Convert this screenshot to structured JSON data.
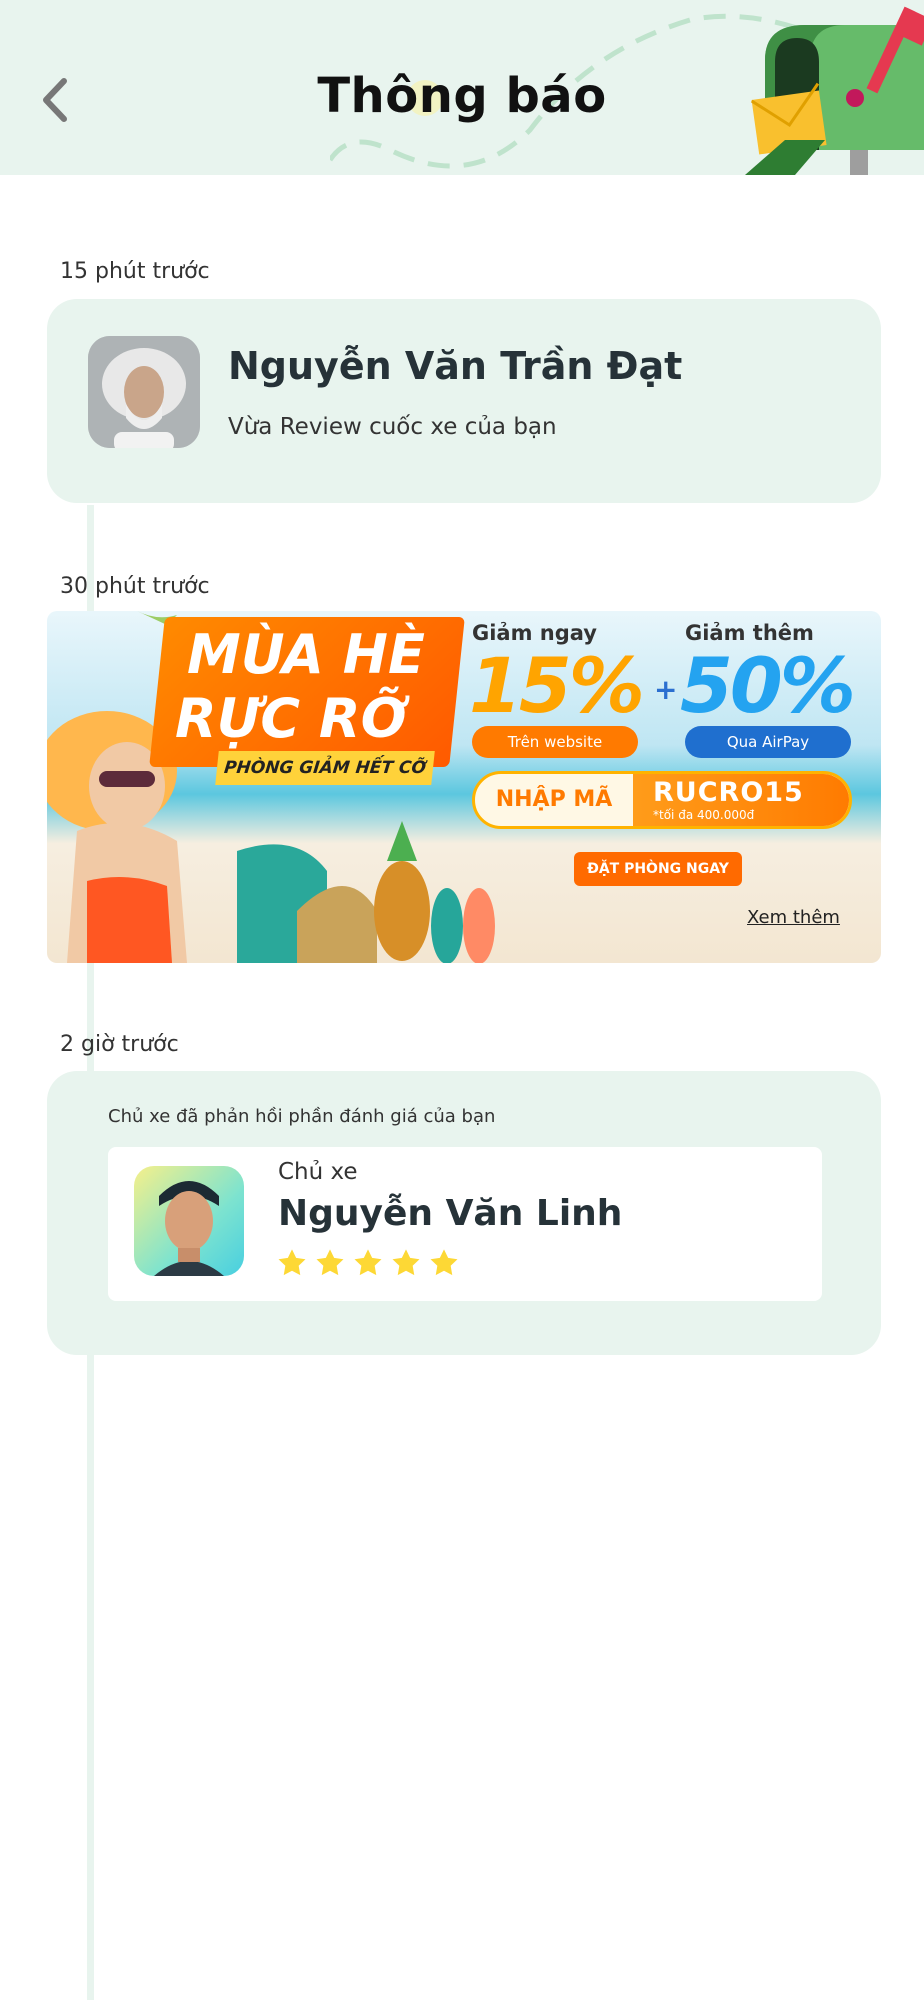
{
  "header": {
    "title": "Thông báo",
    "back_icon": "chevron-left-icon",
    "illustration": "mailbox-icon"
  },
  "notifications": [
    {
      "time": "15 phút trước",
      "user_name": "Nguyễn Văn Trần Đạt",
      "message": "Vừa Review cuốc xe của bạn",
      "avatar": "user-avatar"
    },
    {
      "time": "30 phút trước",
      "banner": {
        "title_line1": "MÙA HÈ",
        "title_line2": "RỰC RỠ",
        "subtitle": "PHÒNG GIẢM HẾT CỠ",
        "label_1": "Giảm ngay",
        "percent_1": "15%",
        "pill_1": "Trên website",
        "label_2": "Giảm thêm",
        "percent_2": "50%",
        "pill_2": "Qua AirPay",
        "code_label": "NHẬP MÃ",
        "code": "RUCRO15",
        "code_note": "*tối đa 400.000đ",
        "cta": "ĐẶT PHÒNG NGAY",
        "more_link": "Xem thêm"
      }
    },
    {
      "time": "2 giờ trước",
      "notice": "Chủ xe đã phản hồi phần đánh giá của bạn",
      "role": "Chủ xe",
      "user_name": "Nguyễn Văn Linh",
      "rating": 5,
      "rating_max": 5,
      "star_color": "#fdd835"
    }
  ],
  "colors": {
    "card_bg": "#e8f4ee",
    "header_bg": "#e8f4ee",
    "text_dark": "#263238"
  }
}
